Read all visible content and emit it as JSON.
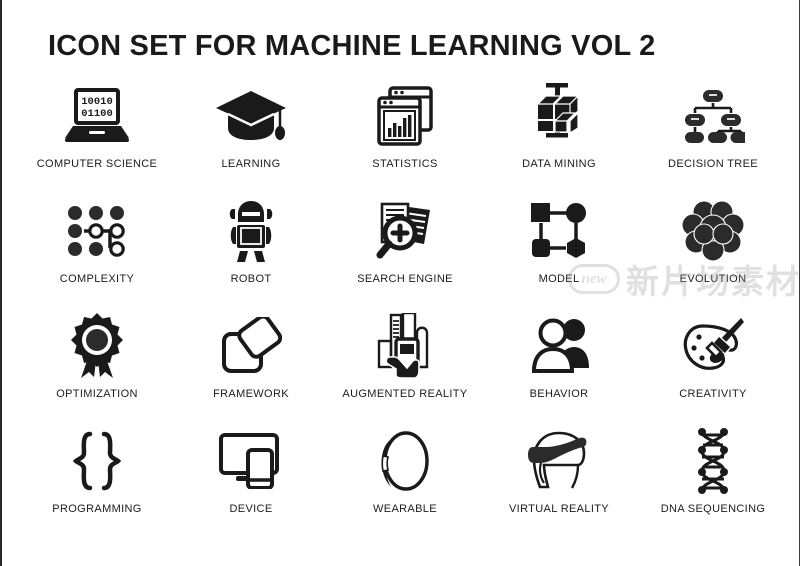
{
  "page": {
    "title": "ICON SET FOR MACHINE LEARNING VOL 2",
    "background_color": "#ffffff",
    "ink_color": "#1a1a1a"
  },
  "watermark": {
    "badge_text": "new",
    "cjk_text": "新片场素材",
    "color": "#9a9a9a"
  },
  "icons": [
    {
      "label": "COMPUTER SCIENCE",
      "icon": "laptop-binary-icon",
      "binary_top": "10010",
      "binary_bottom": "01100"
    },
    {
      "label": "LEARNING",
      "icon": "graduation-cap-icon"
    },
    {
      "label": "STATISTICS",
      "icon": "browser-bar-chart-icon"
    },
    {
      "label": "DATA MINING",
      "icon": "cube-drill-icon"
    },
    {
      "label": "DECISION TREE",
      "icon": "decision-tree-icon"
    },
    {
      "label": "COMPLEXITY",
      "icon": "dot-grid-network-icon"
    },
    {
      "label": "ROBOT",
      "icon": "robot-icon"
    },
    {
      "label": "SEARCH ENGINE",
      "icon": "magnifier-documents-icon"
    },
    {
      "label": "MODEL",
      "icon": "shapes-network-icon"
    },
    {
      "label": "EVOLUTION",
      "icon": "brain-cluster-icon"
    },
    {
      "label": "OPTIMIZATION",
      "icon": "award-ribbon-icon"
    },
    {
      "label": "FRAMEWORK",
      "icon": "overlapping-squares-icon"
    },
    {
      "label": "AUGMENTED REALITY",
      "icon": "hand-phone-city-icon"
    },
    {
      "label": "BEHAVIOR",
      "icon": "people-group-icon"
    },
    {
      "label": "CREATIVITY",
      "icon": "palette-brush-icon"
    },
    {
      "label": "PROGRAMMING",
      "icon": "curly-braces-icon"
    },
    {
      "label": "DEVICE",
      "icon": "monitor-phone-icon"
    },
    {
      "label": "WEARABLE",
      "icon": "watch-band-icon"
    },
    {
      "label": "VIRTUAL REALITY",
      "icon": "vr-headset-head-icon"
    },
    {
      "label": "DNA SEQUENCING",
      "icon": "dna-helix-icon"
    }
  ]
}
